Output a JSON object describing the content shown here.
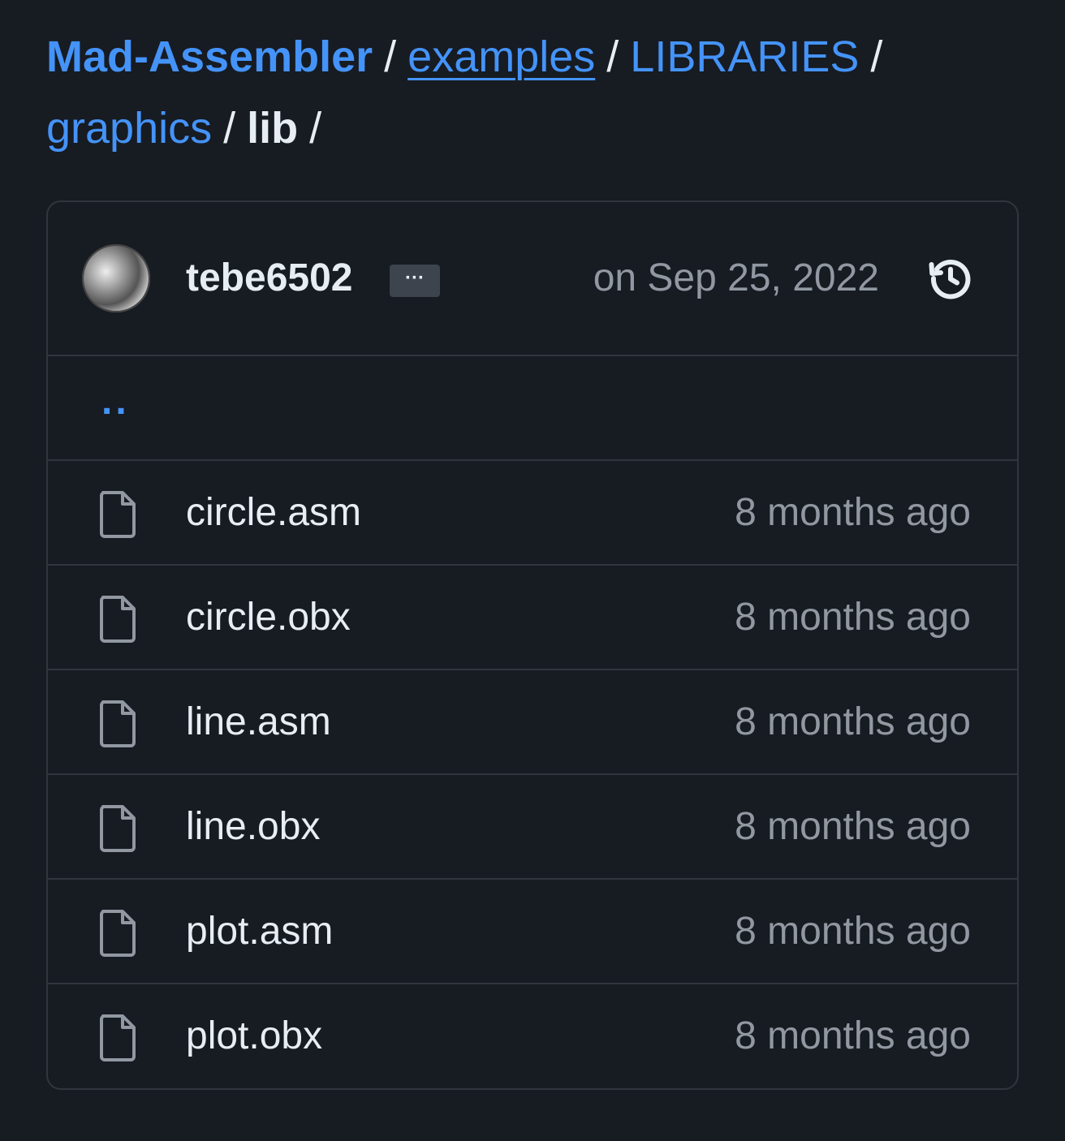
{
  "breadcrumb": {
    "repo": "Mad-Assembler",
    "sep": "/",
    "path_1": "examples",
    "path_2": "LIBRARIES",
    "path_3": "graphics",
    "current": "lib"
  },
  "commit": {
    "author": "tebe6502",
    "more_label": "···",
    "date": "on Sep 25, 2022",
    "history_icon": "history-icon"
  },
  "parent_dir": "..",
  "files": [
    {
      "name": "circle.asm",
      "age": "8 months ago"
    },
    {
      "name": "circle.obx",
      "age": "8 months ago"
    },
    {
      "name": "line.asm",
      "age": "8 months ago"
    },
    {
      "name": "line.obx",
      "age": "8 months ago"
    },
    {
      "name": "plot.asm",
      "age": "8 months ago"
    },
    {
      "name": "plot.obx",
      "age": "8 months ago"
    }
  ],
  "colors": {
    "background": "#171b22",
    "link": "#4493f8",
    "text": "#e6edf3",
    "muted": "#9198a1",
    "border": "#30363d"
  }
}
